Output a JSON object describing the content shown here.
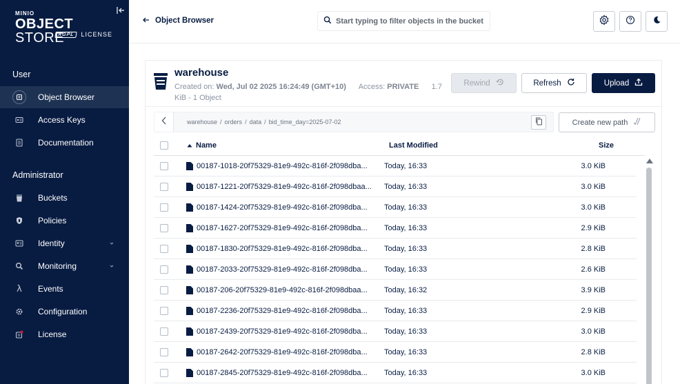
{
  "sidebar": {
    "logo": {
      "brand_small": "MINIO",
      "brand_main_bold": "OBJECT",
      "brand_main_rest": " STORE",
      "badge": "AGPL",
      "license": "LICENSE"
    },
    "section_user": "User",
    "section_admin": "Administrator",
    "user_items": [
      {
        "label": "Object Browser",
        "icon": "object-browser-icon",
        "active": true
      },
      {
        "label": "Access Keys",
        "icon": "access-keys-icon"
      },
      {
        "label": "Documentation",
        "icon": "documentation-icon"
      }
    ],
    "admin_items": [
      {
        "label": "Buckets",
        "icon": "buckets-icon"
      },
      {
        "label": "Policies",
        "icon": "policies-icon"
      },
      {
        "label": "Identity",
        "icon": "identity-icon",
        "expandable": true
      },
      {
        "label": "Monitoring",
        "icon": "monitoring-icon",
        "expandable": true
      },
      {
        "label": "Events",
        "icon": "lambda-icon"
      },
      {
        "label": "Configuration",
        "icon": "gear-icon"
      },
      {
        "label": "License",
        "icon": "license-icon",
        "badge_color": "#c51b3f"
      }
    ]
  },
  "header": {
    "back_label": "Object Browser",
    "search_placeholder": "Start typing to filter objects in the bucket"
  },
  "bucket": {
    "name": "warehouse",
    "created_label": "Created on:",
    "created_value": "Wed, Jul 02 2025 16:24:49 (GMT+10)",
    "access_label": "Access:",
    "access_value": "PRIVATE",
    "size_line1": "1.7",
    "size_line2": "KiB - 1 Object",
    "rewind_label": "Rewind",
    "refresh_label": "Refresh",
    "upload_label": "Upload"
  },
  "path": {
    "crumbs": [
      "warehouse",
      "orders",
      "data",
      "bid_time_day=2025-07-02"
    ],
    "new_path_label": "Create new path"
  },
  "table": {
    "col_name": "Name",
    "col_modified": "Last Modified",
    "col_size": "Size",
    "rows": [
      {
        "name": "00187-1018-20f75329-81e9-492c-816f-2f098dba...",
        "modified": "Today, 16:33",
        "size": "3.0 KiB"
      },
      {
        "name": "00187-1221-20f75329-81e9-492c-816f-2f098dbaa...",
        "modified": "Today, 16:33",
        "size": "3.0 KiB"
      },
      {
        "name": "00187-1424-20f75329-81e9-492c-816f-2f098dba...",
        "modified": "Today, 16:33",
        "size": "3.0 KiB"
      },
      {
        "name": "00187-1627-20f75329-81e9-492c-816f-2f098dba...",
        "modified": "Today, 16:33",
        "size": "2.9 KiB"
      },
      {
        "name": "00187-1830-20f75329-81e9-492c-816f-2f098dba...",
        "modified": "Today, 16:33",
        "size": "2.8 KiB"
      },
      {
        "name": "00187-2033-20f75329-81e9-492c-816f-2f098dba...",
        "modified": "Today, 16:33",
        "size": "2.6 KiB"
      },
      {
        "name": "00187-206-20f75329-81e9-492c-816f-2f098dbaa...",
        "modified": "Today, 16:32",
        "size": "3.9 KiB"
      },
      {
        "name": "00187-2236-20f75329-81e9-492c-816f-2f098dba...",
        "modified": "Today, 16:33",
        "size": "2.9 KiB"
      },
      {
        "name": "00187-2439-20f75329-81e9-492c-816f-2f098dba...",
        "modified": "Today, 16:33",
        "size": "3.0 KiB"
      },
      {
        "name": "00187-2642-20f75329-81e9-492c-816f-2f098dba...",
        "modified": "Today, 16:33",
        "size": "2.8 KiB"
      },
      {
        "name": "00187-2845-20f75329-81e9-492c-816f-2f098dba...",
        "modified": "Today, 16:33",
        "size": "3.0 KiB"
      }
    ]
  },
  "colors": {
    "sidebar_bg": "#081c42",
    "accent": "#081c42",
    "active_item_bg": "#1e3354"
  }
}
